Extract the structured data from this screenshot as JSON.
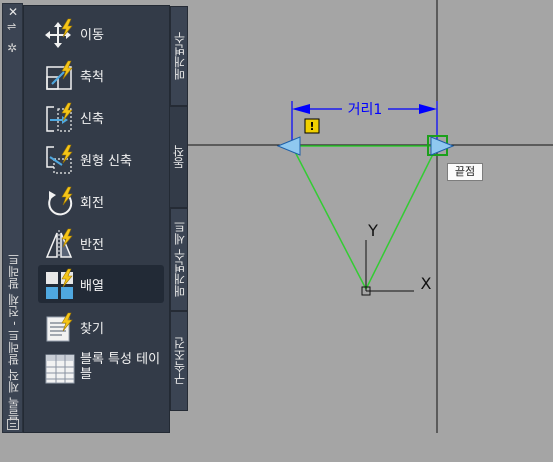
{
  "palette": {
    "title_bar_label": "블록 제작 팔레트 - 전체 팔레트",
    "close_icon": "close-icon",
    "autohide_icon": "autohide-icon",
    "properties_icon": "properties-icon",
    "menu_icon": "palette-menu-icon"
  },
  "tools": [
    {
      "label": "이동",
      "icon": "move-icon"
    },
    {
      "label": "축척",
      "icon": "scale-icon"
    },
    {
      "label": "신축",
      "icon": "stretch-icon"
    },
    {
      "label": "원형 신축",
      "icon": "polar-stretch-icon"
    },
    {
      "label": "회전",
      "icon": "rotate-icon"
    },
    {
      "label": "반전",
      "icon": "flip-icon"
    },
    {
      "label": "배열",
      "icon": "array-icon",
      "selected": true
    },
    {
      "label": "찾기",
      "icon": "lookup-icon"
    },
    {
      "label": "블록 특성 테이블",
      "icon": "block-properties-table-icon"
    }
  ],
  "tabs": [
    {
      "label": "매개변수",
      "active": false
    },
    {
      "label": "동작",
      "active": true
    },
    {
      "label": "매개변수 세트",
      "active": false
    },
    {
      "label": "구속조건",
      "active": false
    }
  ],
  "drawing": {
    "dimension_label": "거리1",
    "tooltip": "끝점",
    "ucs_x": "X",
    "ucs_y": "Y",
    "warning_mark": "!"
  },
  "colors": {
    "canvas": "#a5a5a5",
    "panel": "#333b48",
    "dimension": "#0000ff",
    "triangle": "#33cc33",
    "grip": "#4fa8e0",
    "warning": "#f0d000"
  }
}
